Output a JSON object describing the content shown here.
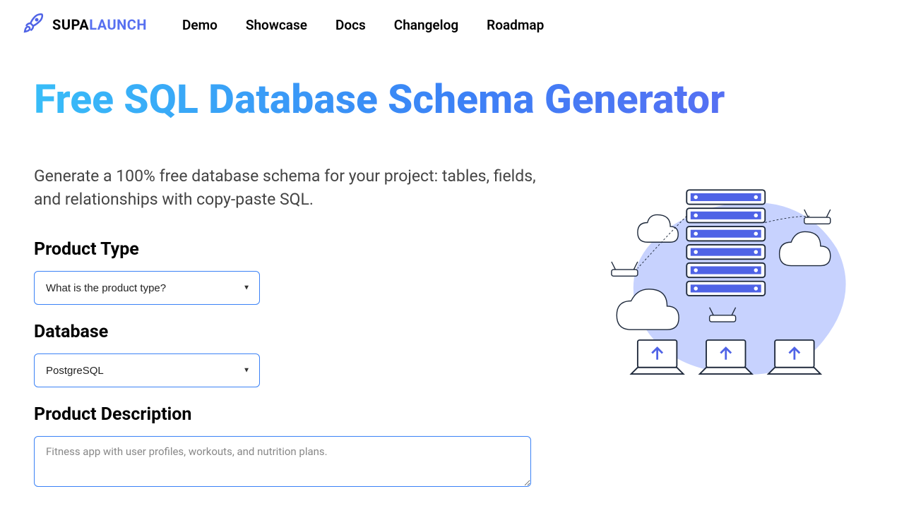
{
  "brand": {
    "part1": "SUPA",
    "part2": "LAUNCH"
  },
  "nav": {
    "items": [
      {
        "label": "Demo"
      },
      {
        "label": "Showcase"
      },
      {
        "label": "Docs"
      },
      {
        "label": "Changelog"
      },
      {
        "label": "Roadmap"
      }
    ]
  },
  "hero": {
    "title": "Free SQL Database Schema Generator",
    "subtitle": "Generate a 100% free database schema for your project: tables, fields, and relationships with copy-paste SQL."
  },
  "form": {
    "product_type": {
      "label": "Product Type",
      "value": "What is the product type?"
    },
    "database": {
      "label": "Database",
      "value": "PostgreSQL"
    },
    "description": {
      "label": "Product Description",
      "placeholder": "Fitness app with user profiles, workouts, and nutrition plans."
    }
  }
}
